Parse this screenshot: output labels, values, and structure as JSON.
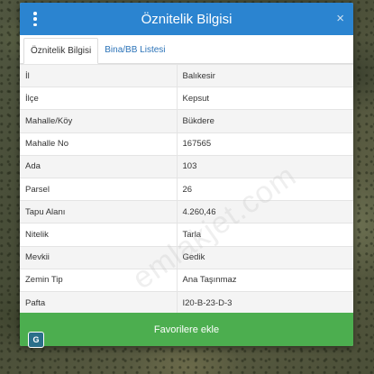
{
  "dialog": {
    "title": "Öznitelik Bilgisi",
    "close_glyph": "×",
    "tabs": [
      {
        "label": "Öznitelik Bilgisi",
        "active": true
      },
      {
        "label": "Bina/BB Listesi",
        "active": false
      }
    ],
    "rows": [
      {
        "key": "İl",
        "value": "Balıkesir"
      },
      {
        "key": "İlçe",
        "value": "Kepsut"
      },
      {
        "key": "Mahalle/Köy",
        "value": "Bükdere"
      },
      {
        "key": "Mahalle No",
        "value": "167565"
      },
      {
        "key": "Ada",
        "value": "103"
      },
      {
        "key": "Parsel",
        "value": "26"
      },
      {
        "key": "Tapu Alanı",
        "value": "4.260,46"
      },
      {
        "key": "Nitelik",
        "value": "Tarla"
      },
      {
        "key": "Mevkii",
        "value": "Gedik"
      },
      {
        "key": "Zemin Tip",
        "value": "Ana Taşınmaz"
      },
      {
        "key": "Pafta",
        "value": "I20-B-23-D-3"
      }
    ],
    "favorite_label": "Favorilere ekle"
  },
  "watermark": "emlakjet.com",
  "colors": {
    "titlebar": "#2b84d0",
    "favorite_button": "#4cae4f",
    "tab_link": "#2b73b8"
  },
  "icons": {
    "menu": "kebab-menu-icon",
    "close": "close-icon",
    "logo": "app-logo-icon"
  }
}
